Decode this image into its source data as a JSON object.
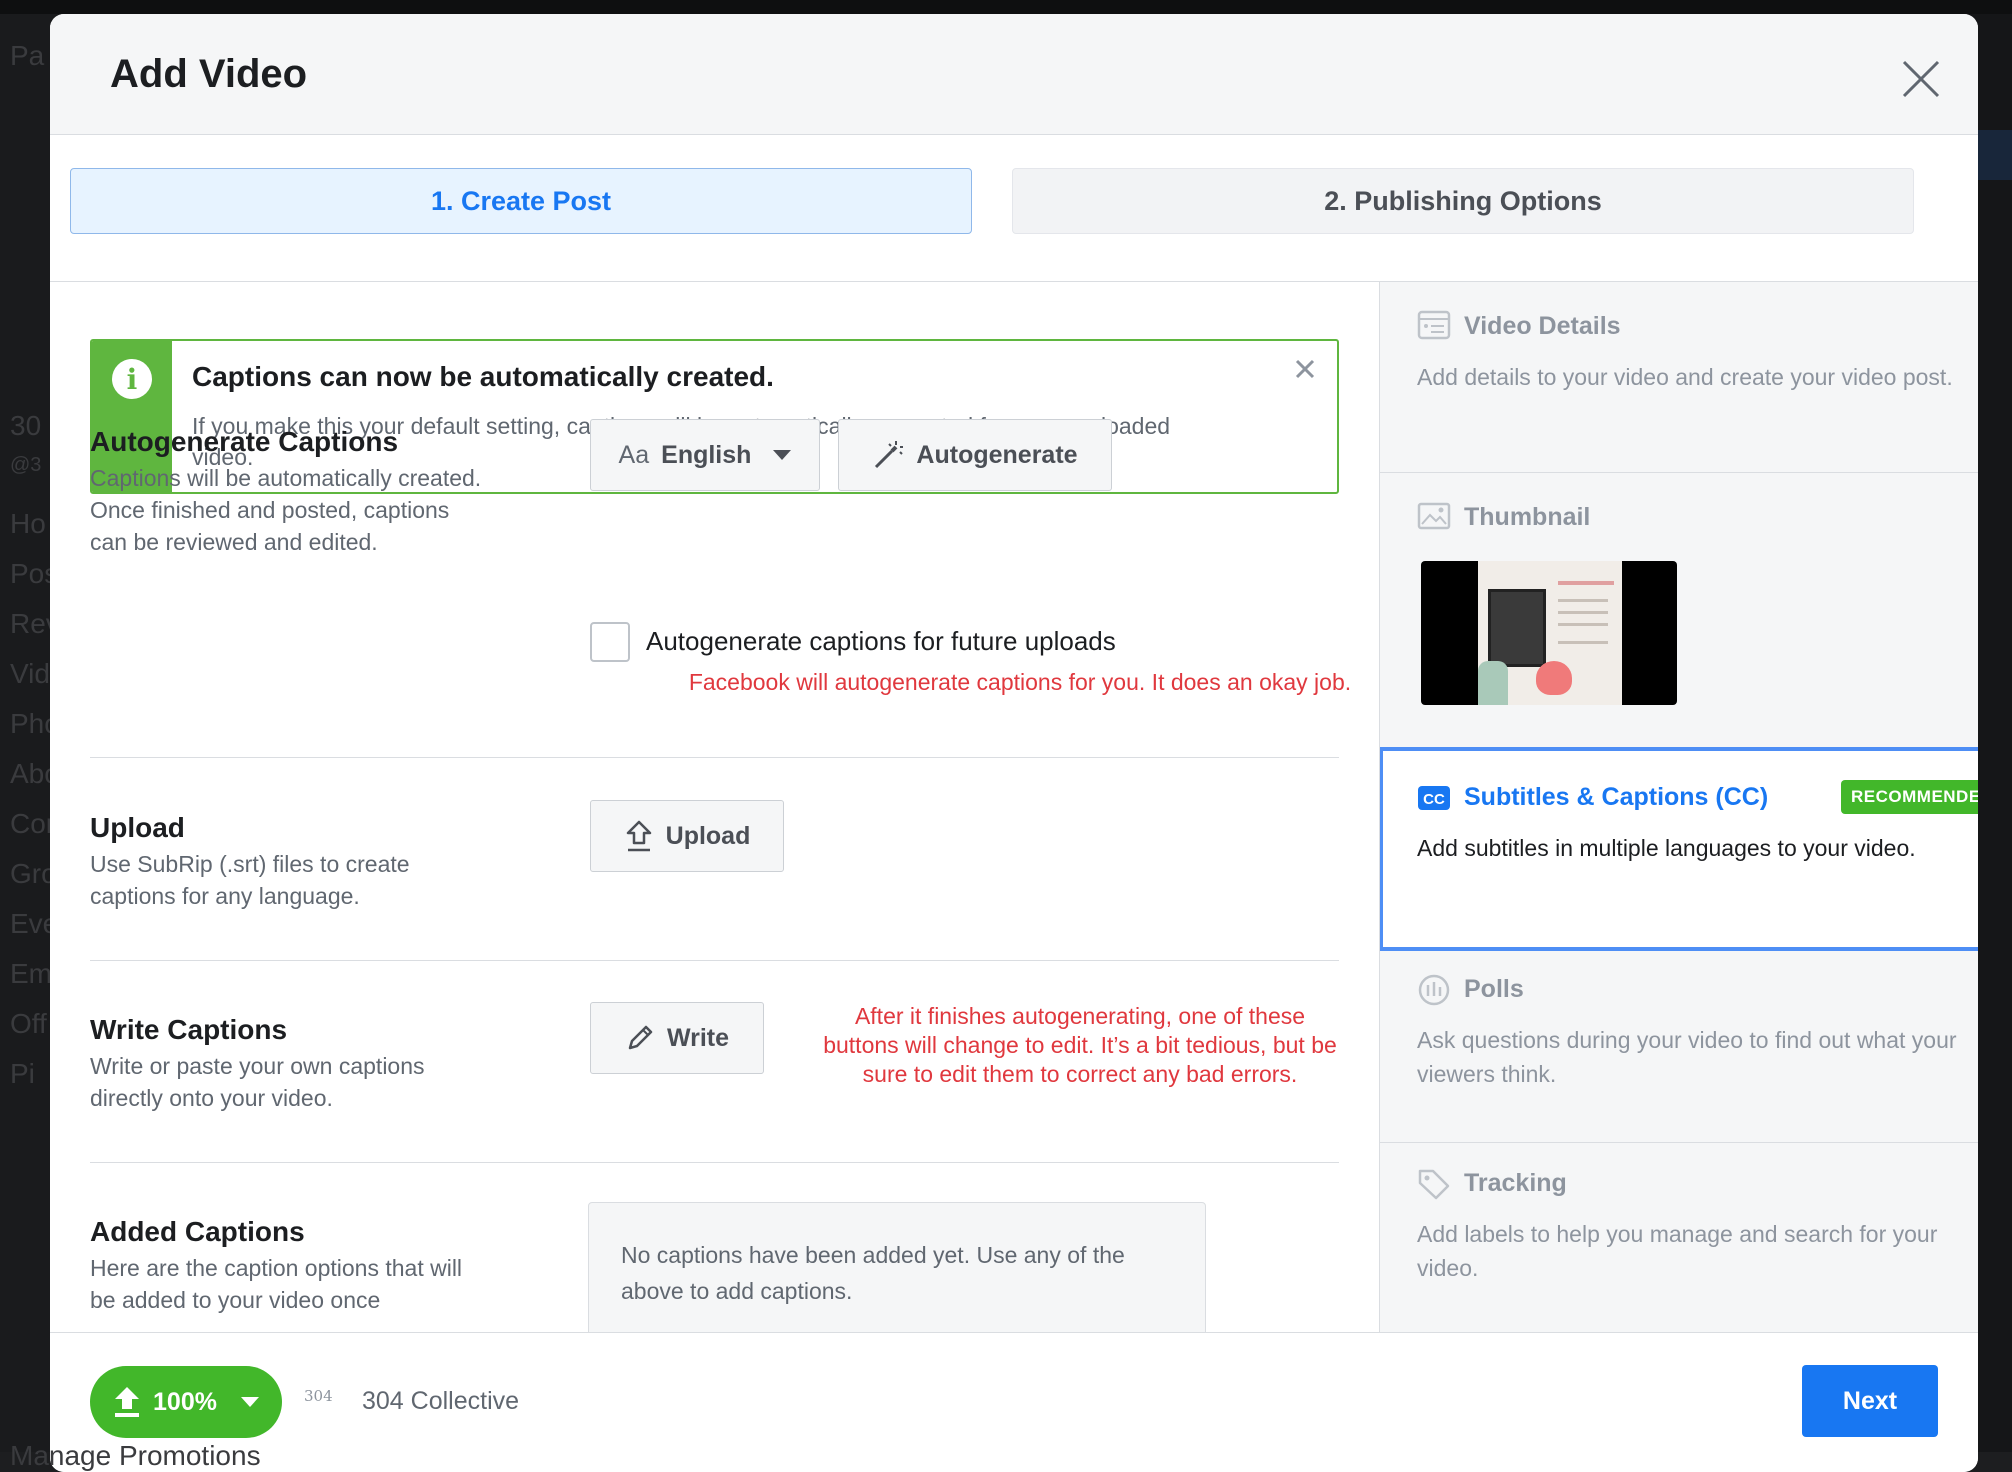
{
  "background": {
    "left_items": [
      "Pa",
      "30",
      "@3",
      "Ho",
      "Pos",
      "Rev",
      "Vid",
      "Pho",
      "Abo",
      "Com",
      "Gro",
      "Eve",
      "Em",
      "Off",
      "Pi"
    ],
    "bottom_text": "Manage Promotions"
  },
  "modal": {
    "title": "Add Video"
  },
  "steps": [
    {
      "label": "1. Create Post",
      "active": true
    },
    {
      "label": "2. Publishing Options",
      "active": false
    }
  ],
  "banner": {
    "title": "Captions can now be automatically created.",
    "text": "If you make this your default setting, captions will be automatically generated for every uploaded video."
  },
  "autogenerate": {
    "title": "Autogenerate Captions",
    "desc": "Captions will be automatically created. Once finished and posted, captions can be reviewed and edited.",
    "language_prefix": "Aa",
    "language": "English",
    "button": "Autogenerate",
    "checkbox_label": "Autogenerate captions for future uploads",
    "annotation": "Facebook will autogenerate captions for you.  It does an okay job."
  },
  "upload": {
    "title": "Upload",
    "desc": "Use SubRip (.srt) files to create captions for any language.",
    "button": "Upload"
  },
  "write": {
    "title": "Write Captions",
    "desc": "Write or paste your own captions directly onto your video.",
    "button": "Write",
    "annotation": "After it finishes autogenerating, one of these buttons will change to edit.  It’s a bit tedious, but be sure to edit them to correct any bad errors."
  },
  "added": {
    "title": "Added Captions",
    "desc": "Here are the caption options that will be added to your video once",
    "empty_text": "No captions have been added yet. Use any of the above to add captions."
  },
  "sidebar": [
    {
      "title": "Video Details",
      "desc": "Add details to your video and create your video post.",
      "icon": "video-details-icon"
    },
    {
      "title": "Thumbnail",
      "icon": "image-icon"
    },
    {
      "title": "Subtitles & Captions (CC)",
      "badge": "RECOMMENDED",
      "desc": "Add subtitles in multiple languages to your video.",
      "icon": "cc-icon",
      "active": true
    },
    {
      "title": "Polls",
      "desc": "Ask questions during your video to find out what your viewers think.",
      "icon": "poll-icon"
    },
    {
      "title": "Tracking",
      "desc": "Add labels to help you manage and search for your video.",
      "icon": "tag-icon"
    }
  ],
  "footer": {
    "progress": "100%",
    "progress_value": 1.0,
    "page_logo_text": "304",
    "page_name": "304 Collective",
    "next": "Next"
  },
  "colors": {
    "accent": "#1877f2",
    "success": "#42b72a",
    "annotation": "#e0383e"
  }
}
